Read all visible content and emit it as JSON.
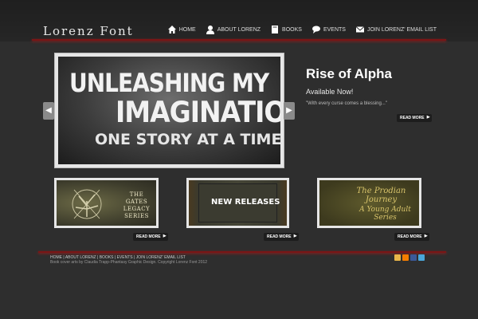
{
  "header": {
    "logo": "Lorenz Font",
    "nav": [
      {
        "label": "HOME",
        "icon": "home-icon"
      },
      {
        "label": "ABOUT LORENZ",
        "icon": "user-icon"
      },
      {
        "label": "BOOKS",
        "icon": "book-icon"
      },
      {
        "label": "EVENTS",
        "icon": "speech-bubble-icon"
      },
      {
        "label": "JOIN LORENZ' EMAIL LIST",
        "icon": "envelope-icon"
      }
    ]
  },
  "hero": {
    "line1": "UNLEASHING MY",
    "line2": "IMAGINATION",
    "line3": "ONE STORY AT A TIME",
    "prev_arrow": "◀",
    "next_arrow": "▶"
  },
  "feature": {
    "title": "Rise of Alpha",
    "subtitle": "Available Now!",
    "quote": "\"With every curse comes a blessing...\"",
    "read_more": "READ MORE"
  },
  "thumbs": [
    {
      "line1": "THE",
      "line2": "GATES LEGACY",
      "line3": "SERIES",
      "read_more": "READ MORE"
    },
    {
      "text": "NEW RELEASES",
      "read_more": "READ MORE"
    },
    {
      "line1": "The Prodian Journey",
      "line2": "A Young Adult Series",
      "read_more": "READ MORE"
    }
  ],
  "footer": {
    "links": [
      "HOME",
      "ABOUT LORENZ",
      "BOOKS",
      "EVENTS",
      "JOIN LORENZ' EMAIL LIST"
    ],
    "separator": " | ",
    "credit": "Book cover arts by Claudia Trapp-Phantasy Graphic Design. Copyright Lorenz Font 2012"
  },
  "social": [
    {
      "icon": "goodreads-icon",
      "color": "#e8b54a"
    },
    {
      "icon": "blogger-icon",
      "color": "#f57d00"
    },
    {
      "icon": "facebook-icon",
      "color": "#3b5998"
    },
    {
      "icon": "twitter-icon",
      "color": "#4aa6d9"
    }
  ],
  "colors": {
    "accent": "#7a1515",
    "background": "#2e2e2e"
  }
}
